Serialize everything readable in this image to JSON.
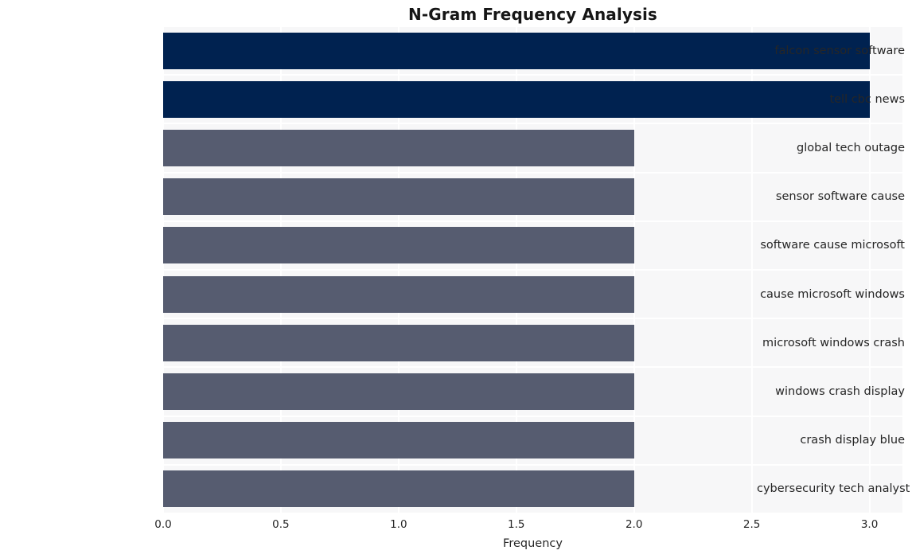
{
  "chart_data": {
    "type": "bar",
    "orientation": "horizontal",
    "title": "N-Gram Frequency Analysis",
    "xlabel": "Frequency",
    "ylabel": "",
    "xlim": [
      0.0,
      3.14
    ],
    "xticks": [
      0.0,
      0.5,
      1.0,
      1.5,
      2.0,
      2.5,
      3.0
    ],
    "xtick_labels": [
      "0.0",
      "0.5",
      "1.0",
      "1.5",
      "2.0",
      "2.5",
      "3.0"
    ],
    "grid": true,
    "grid_color": "#ffffff",
    "legend": null,
    "plot_background": "#f7f7f8",
    "figure_background": "#ffffff",
    "bar_colors": {
      "high": "#002250",
      "low": "#565c70"
    },
    "categories": [
      "falcon sensor software",
      "tell cbc news",
      "global tech outage",
      "sensor software cause",
      "software cause microsoft",
      "cause microsoft windows",
      "microsoft windows crash",
      "windows crash display",
      "crash display blue",
      "cybersecurity tech analyst"
    ],
    "values": [
      3,
      3,
      2,
      2,
      2,
      2,
      2,
      2,
      2,
      2
    ],
    "bars": [
      {
        "label": "falcon sensor software",
        "value": 3,
        "color": "#002250"
      },
      {
        "label": "tell cbc news",
        "value": 3,
        "color": "#002250"
      },
      {
        "label": "global tech outage",
        "value": 2,
        "color": "#565c70"
      },
      {
        "label": "sensor software cause",
        "value": 2,
        "color": "#565c70"
      },
      {
        "label": "software cause microsoft",
        "value": 2,
        "color": "#565c70"
      },
      {
        "label": "cause microsoft windows",
        "value": 2,
        "color": "#565c70"
      },
      {
        "label": "microsoft windows crash",
        "value": 2,
        "color": "#565c70"
      },
      {
        "label": "windows crash display",
        "value": 2,
        "color": "#565c70"
      },
      {
        "label": "crash display blue",
        "value": 2,
        "color": "#565c70"
      },
      {
        "label": "cybersecurity tech analyst",
        "value": 2,
        "color": "#565c70"
      }
    ]
  }
}
